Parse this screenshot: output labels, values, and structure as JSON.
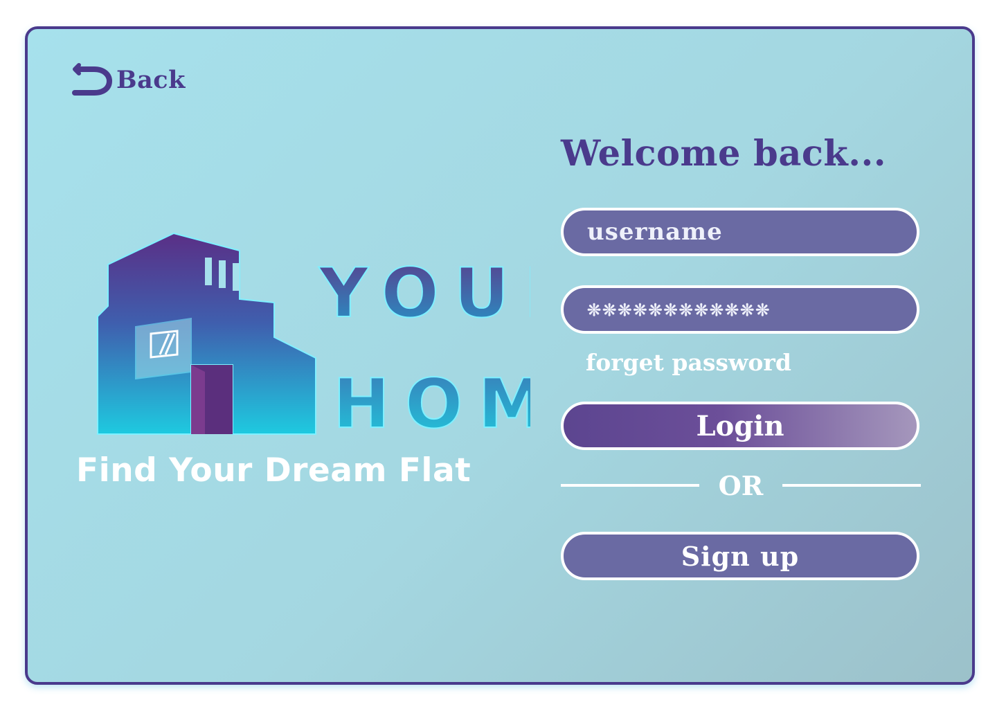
{
  "back": {
    "label": "Back",
    "icon": "back-arrow-icon"
  },
  "brand": {
    "line1": "YOUR",
    "line2": "HOME",
    "tagline": "Find Your Dream Flat",
    "colors": {
      "primary": "#4a3a8c",
      "accent": "#1ec8e0"
    }
  },
  "form": {
    "title": "Welcome back...",
    "username_value": "username",
    "password_value": "❊❊❊❊❊❊❊❊❊❊❊❊",
    "forget_label": "forget password",
    "login_label": "Login",
    "or_label": "OR",
    "signup_label": "Sign up"
  }
}
